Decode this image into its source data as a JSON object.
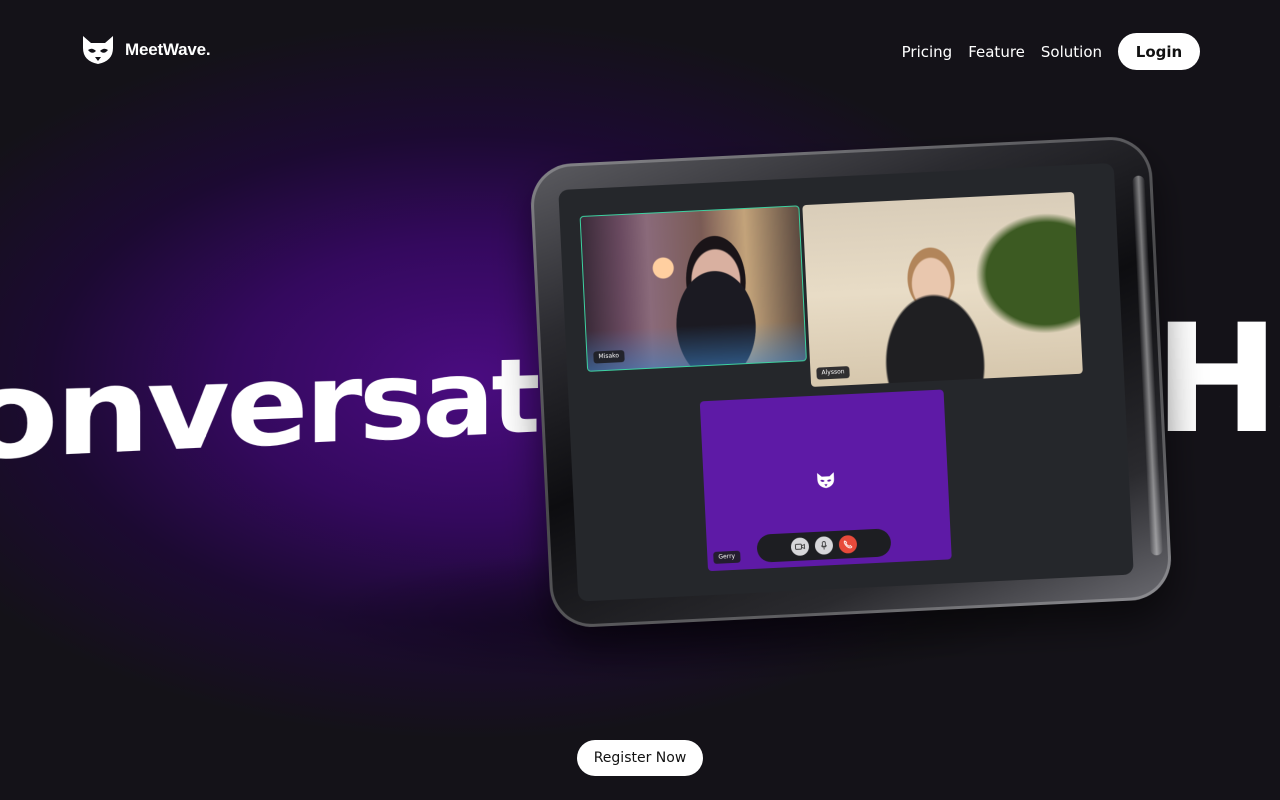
{
  "brand": {
    "name": "MeetWave.",
    "logo_icon": "cat-mask-icon"
  },
  "nav": {
    "links": [
      {
        "label": "Pricing"
      },
      {
        "label": "Feature"
      },
      {
        "label": "Solution"
      }
    ],
    "login_label": "Login"
  },
  "hero": {
    "marquee_left": "Conversati",
    "marquee_right": "Ha"
  },
  "call": {
    "participants": [
      {
        "name": "Misako",
        "active_speaker": true
      },
      {
        "name": "Alysson"
      },
      {
        "name": "Gerry",
        "camera_off_icon": "cat-mask-icon"
      }
    ],
    "controls": [
      {
        "icon": "video-camera-icon"
      },
      {
        "icon": "microphone-icon"
      },
      {
        "icon": "end-call-icon"
      }
    ]
  },
  "cta": {
    "register_label": "Register Now"
  },
  "colors": {
    "background": "#121117",
    "purple_glow": "#4a0c80",
    "camera_off_tile": "#5e1aa6",
    "active_speaker_border": "#3dd1a0",
    "end_call": "#e84a3b"
  }
}
